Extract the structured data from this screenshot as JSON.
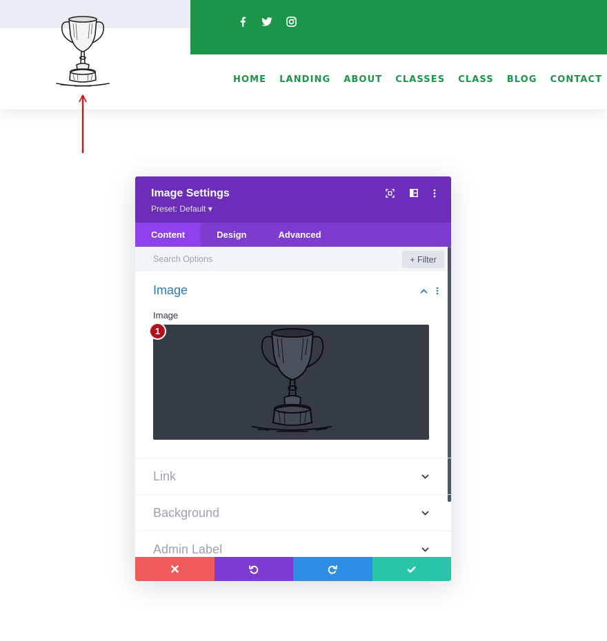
{
  "header": {
    "colors": {
      "green": "#1c9549",
      "strip": "#e9edf3"
    },
    "social": [
      "facebook-icon",
      "twitter-icon",
      "instagram-icon"
    ],
    "nav": [
      "HOME",
      "LANDING",
      "ABOUT",
      "CLASSES",
      "CLASS",
      "BLOG",
      "CONTACT"
    ]
  },
  "modal": {
    "title": "Image Settings",
    "preset": "Preset: Default ▾",
    "header_icons": [
      "focus-icon",
      "columns-icon",
      "more-vertical-icon"
    ],
    "tabs": [
      "Content",
      "Design",
      "Advanced"
    ],
    "active_tab": "Content",
    "search_placeholder": "Search Options",
    "filter_label": "+ Filter",
    "image_section": {
      "title": "Image",
      "field_label": "Image",
      "badge": "1"
    },
    "collapsed_sections": [
      "Link",
      "Background",
      "Admin Label"
    ],
    "footer": [
      {
        "icon": "close-icon",
        "color": "#ef5a5a"
      },
      {
        "icon": "undo-icon",
        "color": "#7c3bd1"
      },
      {
        "icon": "redo-icon",
        "color": "#2f8de4"
      },
      {
        "icon": "check-icon",
        "color": "#29c4a9"
      }
    ],
    "colors": {
      "header": "#6c2eb9",
      "tabs": "#7e3bd0",
      "active_tab": "#8f42ec",
      "section_title": "#2b7bc0"
    }
  }
}
